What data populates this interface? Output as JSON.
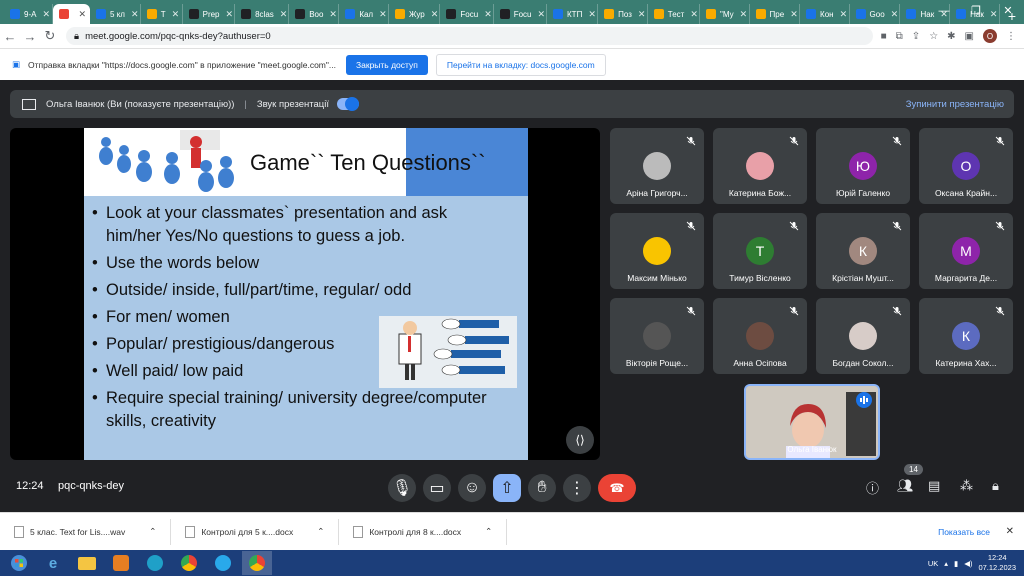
{
  "tabs": [
    {
      "label": "9-А",
      "color": "#1a73e8"
    },
    {
      "label": "",
      "color": "#ea4335",
      "active": true
    },
    {
      "label": "5 кл",
      "color": "#1a73e8"
    },
    {
      "label": "Т",
      "color": "#f9ab00"
    },
    {
      "label": "Prep",
      "color": "#202124"
    },
    {
      "label": "8clas",
      "color": "#202124"
    },
    {
      "label": "Boo",
      "color": "#202124"
    },
    {
      "label": "Кал",
      "color": "#1a73e8"
    },
    {
      "label": "Жур",
      "color": "#f9ab00"
    },
    {
      "label": "Focu",
      "color": "#202124"
    },
    {
      "label": "Focu",
      "color": "#202124"
    },
    {
      "label": "КТП",
      "color": "#1a73e8"
    },
    {
      "label": "Поз",
      "color": "#f9ab00"
    },
    {
      "label": "Тест",
      "color": "#f9ab00"
    },
    {
      "label": "\"Му",
      "color": "#f9ab00"
    },
    {
      "label": "Пре",
      "color": "#f9ab00"
    },
    {
      "label": "Кон",
      "color": "#1a73e8"
    },
    {
      "label": "Goo",
      "color": "#1a73e8"
    },
    {
      "label": "Нак",
      "color": "#1a73e8"
    },
    {
      "label": "Нак",
      "color": "#1a73e8"
    }
  ],
  "address": {
    "url": "meet.google.com/pqc-qnks-dey?authuser=0",
    "profile_initial": "О"
  },
  "infobar": {
    "message": "Отправка вкладки \"https://docs.google.com\" в приложение \"meet.google.com\"...",
    "grant_label": "Закрыть доступ",
    "switch_label": "Перейти на вкладку: docs.google.com"
  },
  "presenting": {
    "presenter": "Ольга Іванюк (Ви (показуєте презентацію))",
    "audio_label": "Звук презентації",
    "stop_label": "Зупинити презентацію"
  },
  "slide": {
    "title": "Game`` Ten Questions``",
    "bullets": [
      "Look at your classmates` presentation and ask him/her Yes/No questions to guess a job.",
      "Use the words below",
      "Outside/ inside, full/part/time, regular/ odd",
      "For men/ women",
      "Popular/ prestigious/dangerous",
      "Well paid/ low paid",
      "Require special training/ university degree/computer skills, creativity"
    ]
  },
  "participants": [
    {
      "name": "Аріна Григорч...",
      "initial": "",
      "color": "#bbbbbb"
    },
    {
      "name": "Катерина Бож...",
      "initial": "",
      "color": "#e8a0a8"
    },
    {
      "name": "Юрій Галенко",
      "initial": "Ю",
      "color": "#8e24aa"
    },
    {
      "name": "Оксана Крайн...",
      "initial": "О",
      "color": "#5e35b1"
    },
    {
      "name": "Максим Мінько",
      "initial": "",
      "color": "#f9c400"
    },
    {
      "name": "Тимур Вісленко",
      "initial": "Т",
      "color": "#2e7d32"
    },
    {
      "name": "Крістіан Мушт...",
      "initial": "К",
      "color": "#a1887f"
    },
    {
      "name": "Маргарита Де...",
      "initial": "М",
      "color": "#8e24aa"
    },
    {
      "name": "Вікторія Роще...",
      "initial": "",
      "color": "#555555"
    },
    {
      "name": "Анна Осіпова",
      "initial": "",
      "color": "#6d4c41"
    },
    {
      "name": "Богдан Сокол...",
      "initial": "",
      "color": "#d7ccc8"
    },
    {
      "name": "Катерина Хах...",
      "initial": "К",
      "color": "#5c6bc0"
    }
  ],
  "self": {
    "name": "Ольга Іванюк"
  },
  "bottom": {
    "time": "12:24",
    "meeting_code": "pqc-qnks-dey",
    "people_count": "14"
  },
  "downloads": [
    {
      "name": "5 клас. Text for Lis....wav"
    },
    {
      "name": "Контролі для 5 к....docx"
    },
    {
      "name": "Контролі для 8 к....docx"
    }
  ],
  "downloads_show_all": "Показать все",
  "taskbar": {
    "lang": "UK",
    "time": "12:24",
    "date": "07.12.2023"
  }
}
